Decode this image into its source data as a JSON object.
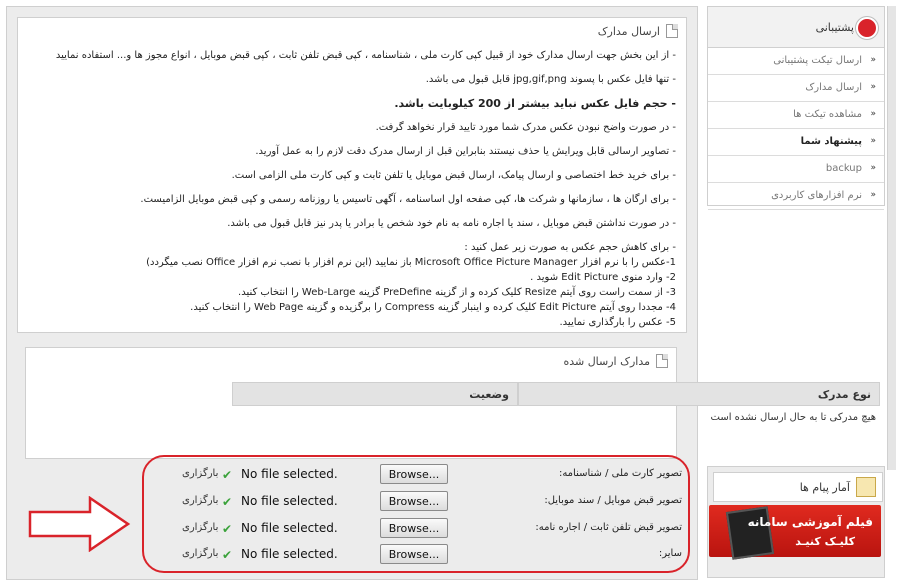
{
  "send_docs": {
    "title": "ارسال مدارک",
    "rules": [
      "- از این بخش جهت ارسال مدارک خود از قبیل کپی کارت ملی ، شناسنامه ، کپی قبض تلفن ثابت ، کپی قبض موبایل ، انواع مجوز ها و... استفاده نمایید",
      "- تنها فایل عکس با پسوند jpg,gif,png قابل قبول می باشد.",
      "- حجم فایل عکس نباید بیشتر از 200 کیلوبایت باشد.",
      "- در صورت واضح نبودن عکس مدرک شما مورد تایید قرار نخواهد گرفت.",
      "- تصاویر ارسالی قابل ویرایش یا حذف نیستند بنابراین قبل از ارسال مدرک دقت لازم را به عمل آورید.",
      "- برای خرید خط اختصاصی و ارسال پیامک، ارسال قبض موبایل یا تلفن ثابت و کپی کارت ملی الزامی است.",
      "- برای ارگان ها ، سازمانها و شرکت ها، کپی صفحه اول اساسنامه ، آگهی تاسیس یا روزنامه رسمی و کپی قبض موبایل الزامیست.",
      "- در صورت نداشتن قبض موبایل ، سند یا اجاره نامه به نام خود شخص یا برادر یا پدر نیز قابل قبول می باشد."
    ],
    "steps": [
      "- برای کاهش حجم عکس به صورت زیر عمل کنید :",
      "1-عکس را با نرم افزار Microsoft Office Picture Manager باز نمایید (این نرم افزار با نصب نرم افزار Office نصب میگردد)",
      "2- وارد منوی Edit Picture شوید .",
      "3- از سمت راست روی آیتم Resize کلیک کرده و از گزینه PreDefine گزینه Web-Large را انتخاب کنید.",
      "4- مجددا روی آیتم Edit Picture کلیک کرده و اینبار گزینه Compress را برگزیده و گزینه Web Page را انتخاب کنید.",
      "5- عکس را بارگذاری نمایید."
    ]
  },
  "sent_docs": {
    "title": "مدارک ارسال شده",
    "col_type": "نوع مدرک",
    "col_status": "وضعیت",
    "empty": "هیچ مدرکی تا به حال ارسال نشده است"
  },
  "uploads": [
    {
      "label": "تصویر کارت ملی / شناسنامه:",
      "browse": "Browse...",
      "file": "No file selected.",
      "upload": "بارگزاری"
    },
    {
      "label": "تصویر قبض موبایل / سند موبایل:",
      "browse": "Browse...",
      "file": "No file selected.",
      "upload": "بارگزاری"
    },
    {
      "label": "تصویر قبض تلفن ثابت / اجاره نامه:",
      "browse": "Browse...",
      "file": "No file selected.",
      "upload": "بارگزاری"
    },
    {
      "label": "سایر:",
      "browse": "Browse...",
      "file": "No file selected.",
      "upload": "بارگزاری"
    }
  ],
  "sidebar": {
    "title": "پشتیبانی",
    "items": [
      {
        "label": "ارسال تیکت پشتیبانی"
      },
      {
        "label": "ارسال مدارک"
      },
      {
        "label": "مشاهده تیکت ها"
      },
      {
        "label": "پیشنهاد شما"
      },
      {
        "label": "backup"
      },
      {
        "label": "نرم افزارهای کاربردی"
      }
    ],
    "stats": "آمار پیام ها",
    "promo_line1": "فیلم آموزشی سامانه",
    "promo_line2": "کلیـک کنیـد"
  },
  "colors": {
    "accent": "#d9232a",
    "check": "#3aa23a"
  }
}
